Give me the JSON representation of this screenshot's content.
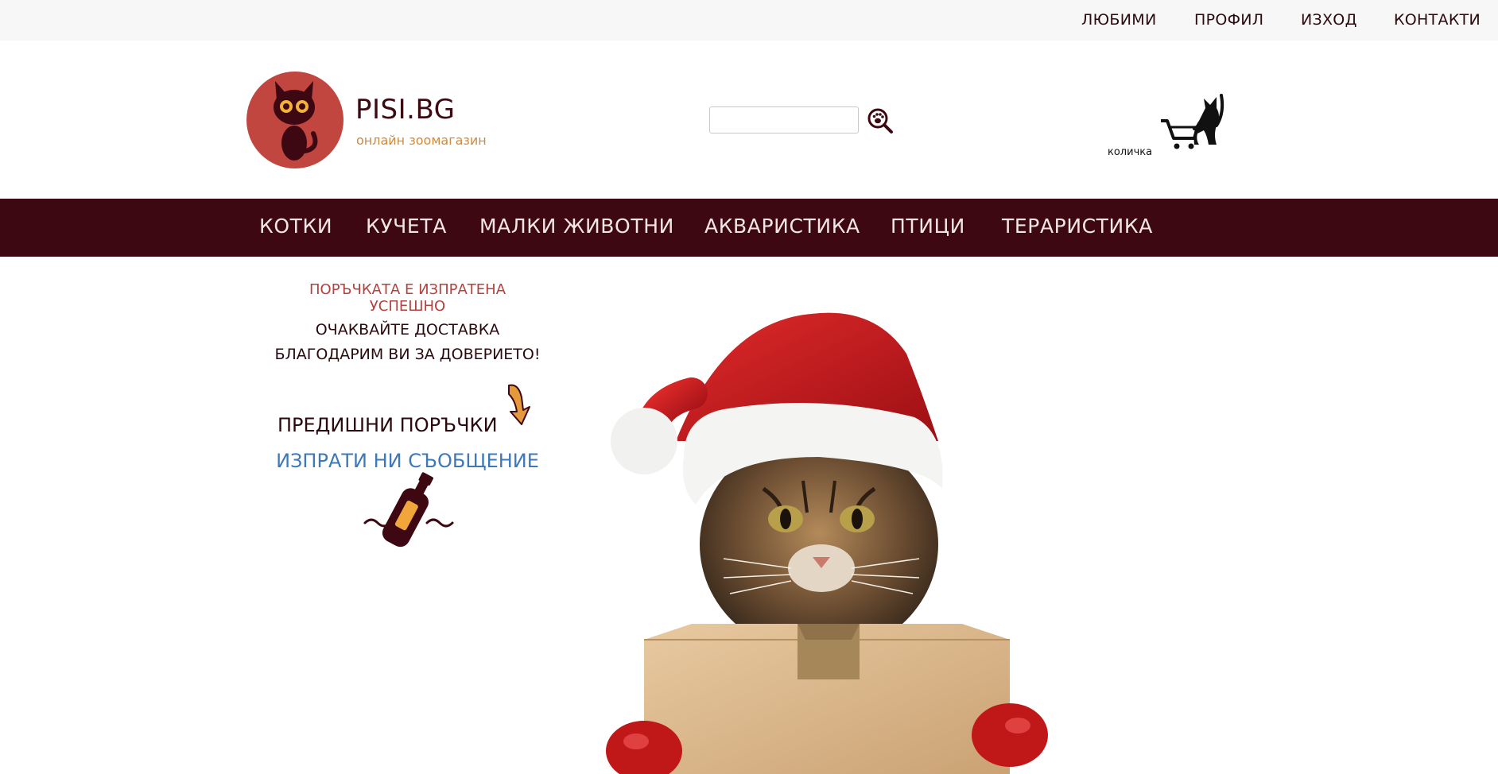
{
  "top_nav": {
    "favorites": "ЛЮБИМИ",
    "profile": "ПРОФИЛ",
    "logout": "ИЗХОД",
    "contacts": "КОНТАКТИ"
  },
  "brand": {
    "name": "PISI.BG",
    "tagline": "онлайн зоомагазин"
  },
  "search": {
    "value": "",
    "placeholder": "",
    "icon": "paw-search-icon"
  },
  "cart": {
    "label": "количка",
    "icon": "cat-cart-icon"
  },
  "main_nav": {
    "items": [
      "КОТКИ",
      "КУЧЕТА",
      "МАЛКИ ЖИВОТНИ",
      "АКВАРИСТИКА",
      "ПТИЦИ",
      "ТЕРАРИСТИКА"
    ]
  },
  "confirmation": {
    "line1a": "ПОРЪЧКАТА Е ИЗПРАТЕНА",
    "line1b": "УСПЕШНО",
    "line2": "ОЧАКВАЙТЕ ДОСТАВКА",
    "line3": "БЛАГОДАРИМ ВИ ЗА ДОВЕРИЕТО!"
  },
  "links": {
    "previous_orders": "ПРЕДИШНИ ПОРЪЧКИ",
    "send_message": "ИЗПРАТИ НИ СЪОБЩЕНИЕ"
  },
  "colors": {
    "nav_background": "#3d0812",
    "accent_red": "#c0463f",
    "tagline_orange": "#d08a3c",
    "link_blue": "#3d79b8"
  }
}
